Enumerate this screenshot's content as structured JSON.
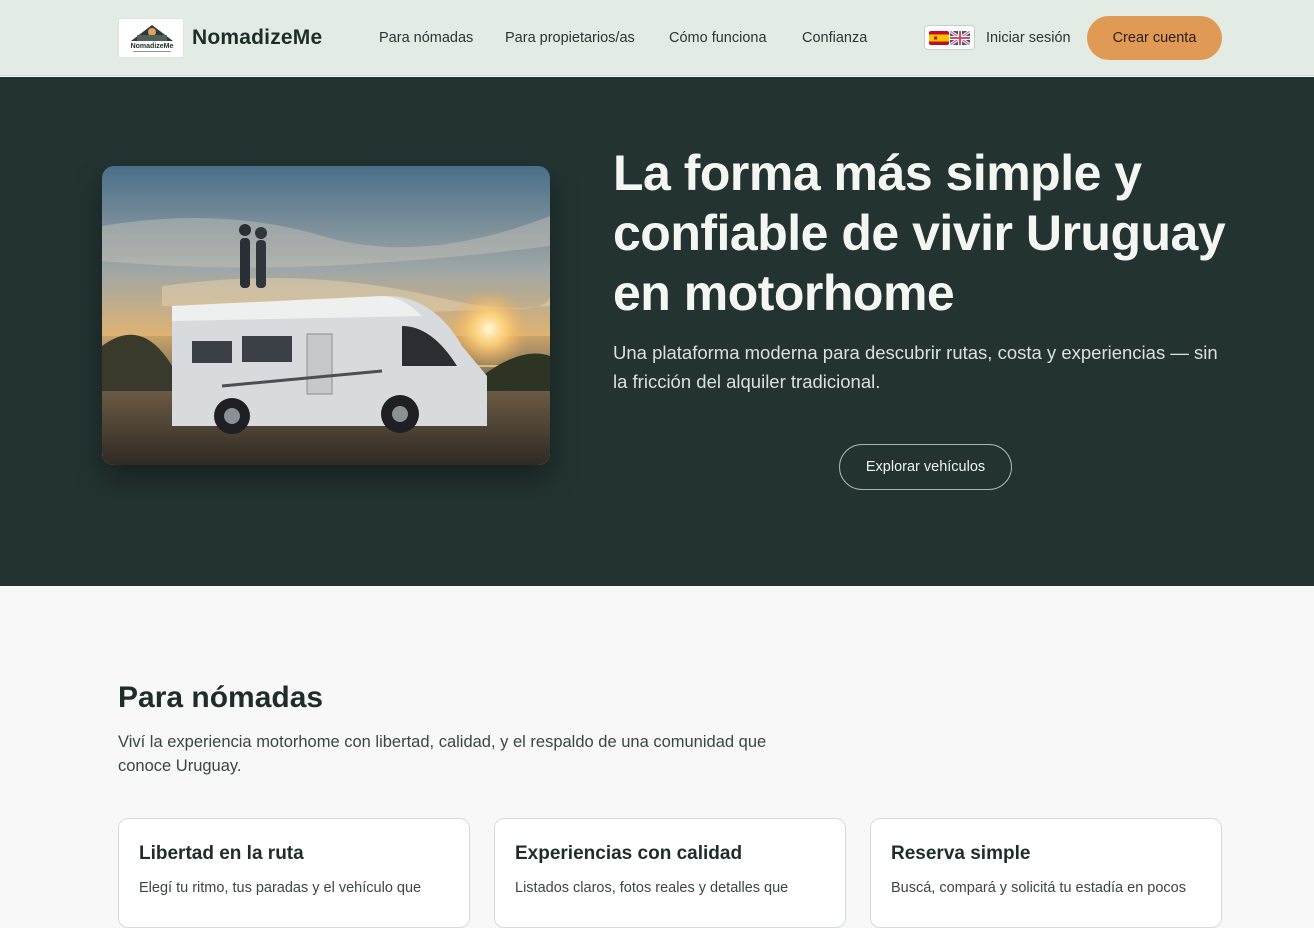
{
  "header": {
    "brand": "NomadizeMe",
    "logo_text": "NomadizeMe",
    "nav": [
      {
        "label": "Para nómadas"
      },
      {
        "label": "Para propietarios/as"
      },
      {
        "label": "Cómo funciona"
      },
      {
        "label": "Confianza"
      }
    ],
    "languages": [
      "es",
      "en"
    ],
    "login_label": "Iniciar sesión",
    "signup_label": "Crear cuenta"
  },
  "hero": {
    "title": "La forma más simple y confiable de vivir Uruguay en motorhome",
    "subtitle": "Una plataforma moderna para descubrir rutas, costa y experiencias — sin la fricción del alquiler tradicional.",
    "cta_label": "Explorar vehículos"
  },
  "nomads": {
    "title": "Para nómadas",
    "description": "Viví la experiencia motorhome con libertad, calidad, y el respaldo de una comunidad que conoce Uruguay.",
    "cards": [
      {
        "title": "Libertad en la ruta",
        "text": "Elegí tu ritmo, tus paradas y el vehículo que"
      },
      {
        "title": "Experiencias con calidad",
        "text": "Listados claros, fotos reales y detalles que"
      },
      {
        "title": "Reserva simple",
        "text": "Buscá, compará y solicitá tu estadía en pocos"
      }
    ]
  },
  "colors": {
    "header_bg": "#e3ebe5",
    "hero_bg": "#223331",
    "accent": "#e09a55",
    "text_dark": "#1f2d2a"
  }
}
